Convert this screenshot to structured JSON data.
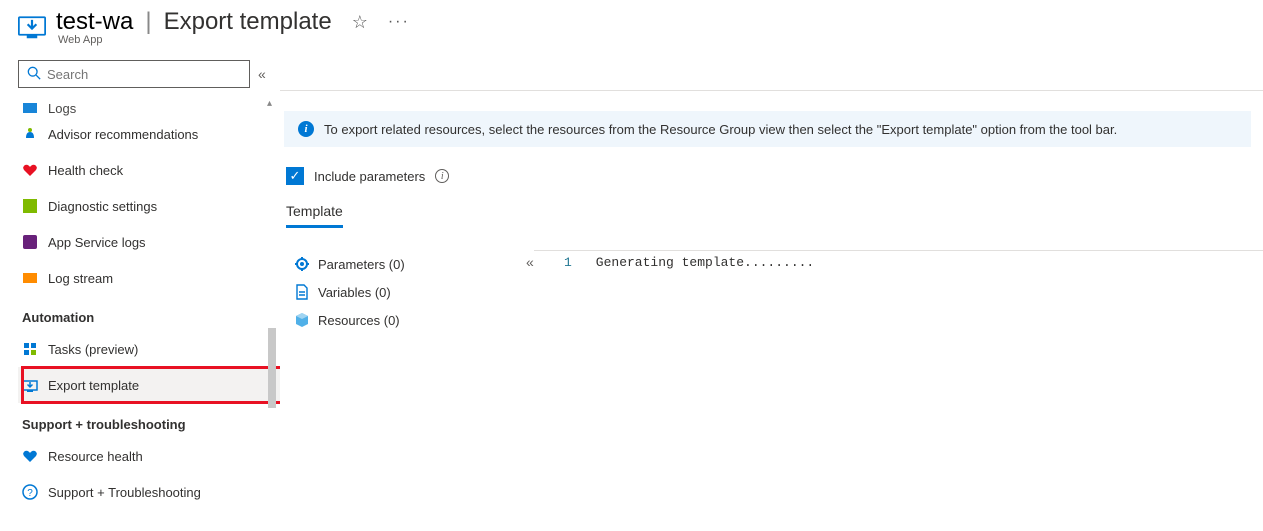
{
  "header": {
    "resource_name": "test-wa",
    "page_title": "Export template",
    "resource_type": "Web App"
  },
  "sidebar": {
    "search_placeholder": "Search",
    "partial_item": "Logs",
    "items": [
      {
        "label": "Advisor recommendations",
        "icon": "advisor"
      },
      {
        "label": "Health check",
        "icon": "health"
      },
      {
        "label": "Diagnostic settings",
        "icon": "diagnostic"
      },
      {
        "label": "App Service logs",
        "icon": "appservice"
      },
      {
        "label": "Log stream",
        "icon": "logstream"
      }
    ],
    "section_automation": "Automation",
    "automation_items": [
      {
        "label": "Tasks (preview)",
        "icon": "tasks"
      },
      {
        "label": "Export template",
        "icon": "export",
        "active": true
      }
    ],
    "section_support": "Support + troubleshooting",
    "support_items": [
      {
        "label": "Resource health",
        "icon": "reshealth"
      },
      {
        "label": "Support + Troubleshooting",
        "icon": "support"
      }
    ]
  },
  "main": {
    "info_text": "To export related resources, select the resources from the Resource Group view then select the \"Export template\" option from the tool bar.",
    "checkbox_label": "Include parameters",
    "tab_label": "Template",
    "tree": {
      "parameters": "Parameters (0)",
      "variables": "Variables (0)",
      "resources": "Resources (0)"
    },
    "editor": {
      "line_number": "1",
      "line_text": "Generating template........."
    }
  }
}
